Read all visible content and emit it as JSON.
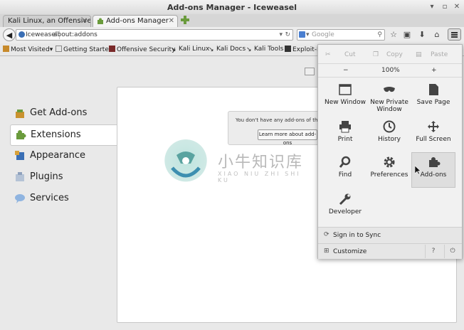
{
  "window": {
    "title": "Add-ons Manager - Iceweasel"
  },
  "tabs": [
    {
      "label": "Kali Linux, an Offensive ..."
    },
    {
      "label": "Add-ons Manager"
    }
  ],
  "navbar": {
    "identity": "Iceweasel",
    "url": "about:addons",
    "search_placeholder": "Google"
  },
  "bookmarks": [
    {
      "label": "Most Visited"
    },
    {
      "label": "Getting Started"
    },
    {
      "label": "Offensive Security"
    },
    {
      "label": "Kali Linux"
    },
    {
      "label": "Kali Docs"
    },
    {
      "label": "Kali Tools"
    },
    {
      "label": "Exploit-D"
    }
  ],
  "sidebar": {
    "items": [
      {
        "label": "Get Add-ons",
        "icon": "get-addons-icon"
      },
      {
        "label": "Extensions",
        "icon": "extensions-icon",
        "selected": true
      },
      {
        "label": "Appearance",
        "icon": "appearance-icon"
      },
      {
        "label": "Plugins",
        "icon": "plugins-icon"
      },
      {
        "label": "Services",
        "icon": "services-icon"
      }
    ]
  },
  "main": {
    "empty_message": "You don't have any add-ons of this typ",
    "learn_more": "Learn more about add-ons"
  },
  "menu": {
    "cut": "Cut",
    "copy": "Copy",
    "paste": "Paste",
    "zoom_out": "−",
    "zoom_level": "100%",
    "zoom_in": "+",
    "items": [
      {
        "label": "New Window"
      },
      {
        "label": "New Private Window"
      },
      {
        "label": "Save Page"
      },
      {
        "label": "Print"
      },
      {
        "label": "History"
      },
      {
        "label": "Full Screen"
      },
      {
        "label": "Find"
      },
      {
        "label": "Preferences"
      },
      {
        "label": "Add-ons"
      },
      {
        "label": "Developer"
      }
    ],
    "sync": "Sign in to Sync",
    "customize": "Customize"
  },
  "watermark": {
    "cn": "小牛知识库",
    "en": "XIAO NIU ZHI SHI KU"
  },
  "colors": {
    "accent": "#3a6fb5",
    "addons_green": "#6a9b3c"
  }
}
